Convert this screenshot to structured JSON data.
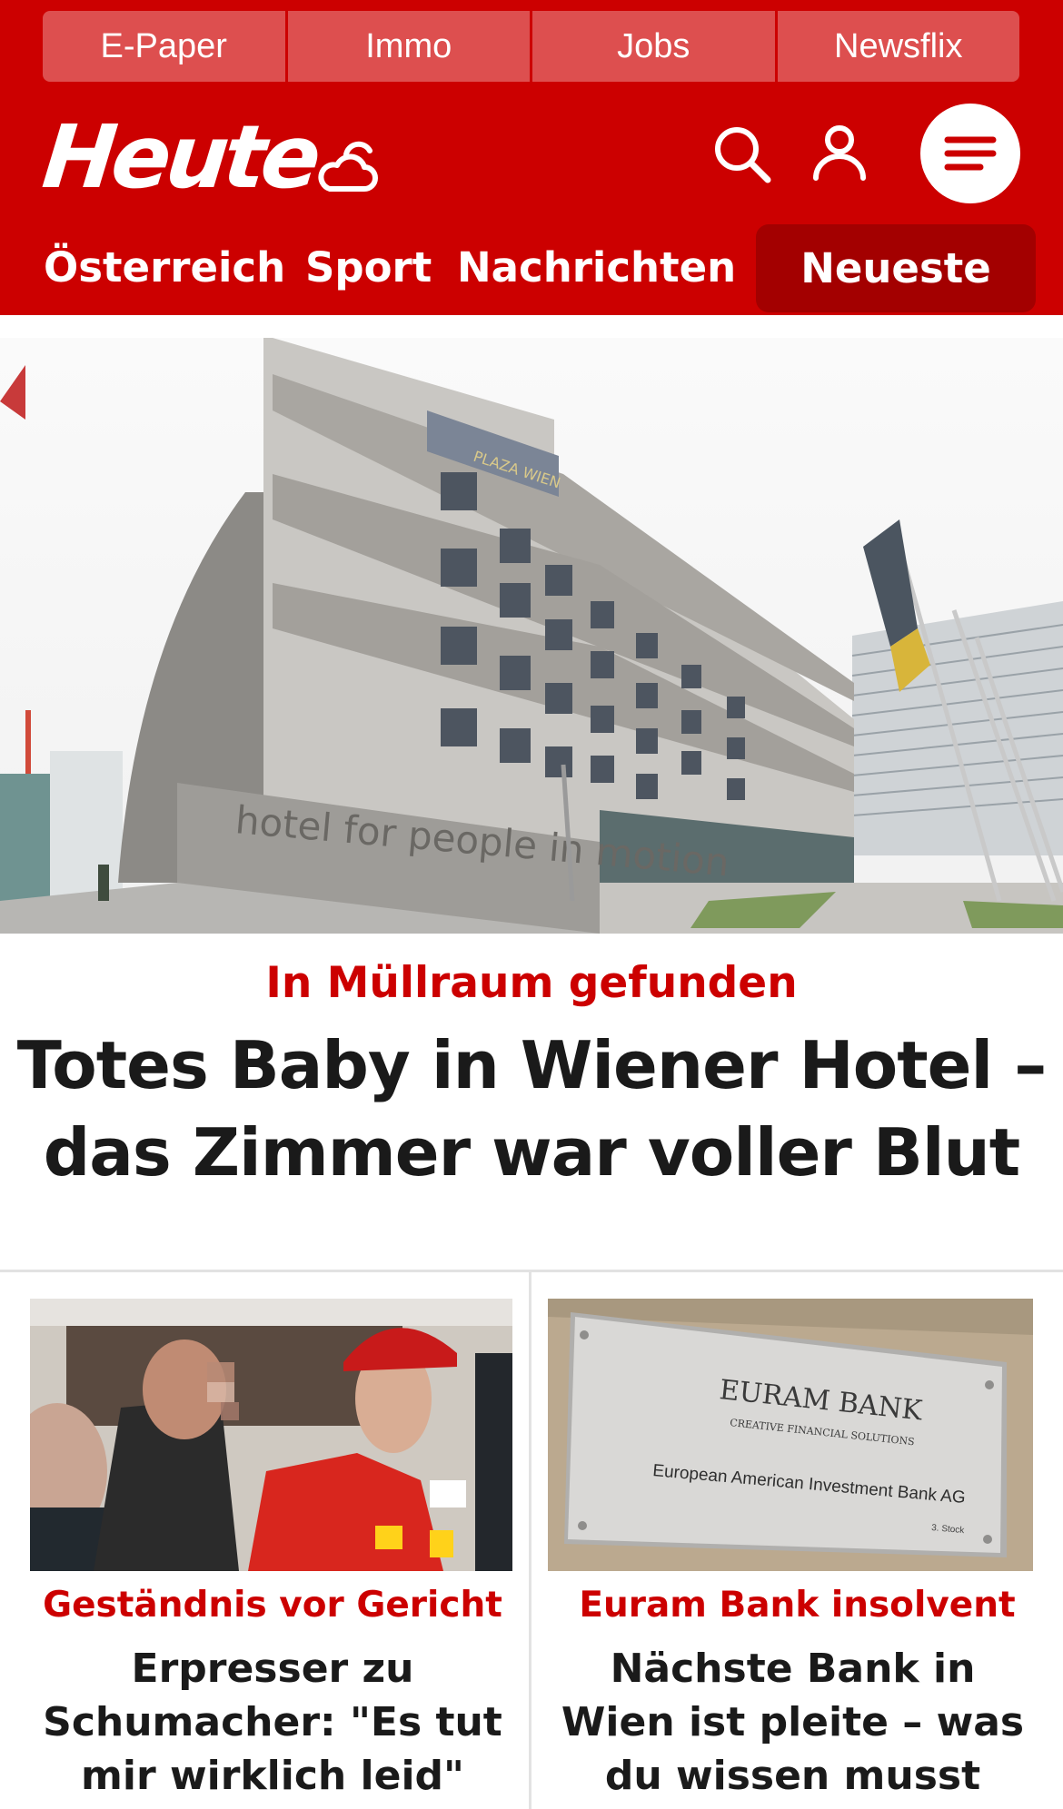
{
  "services": [
    "E-Paper",
    "Immo",
    "Jobs",
    "Newsflix"
  ],
  "brand": {
    "logo": "Heute",
    "weather_icon": "cloud-sun-icon"
  },
  "header_icons": {
    "search": "search-icon",
    "account": "user-icon",
    "menu": "hamburger-menu-icon"
  },
  "nav": {
    "osterreich": "Österreich",
    "sport": "Sport",
    "nachrichten": "Nachrichten",
    "neueste": "Neueste"
  },
  "hero": {
    "image_text": "hotel for people in motion",
    "sign_text": "PLAZA WIEN",
    "kicker": "In Müllraum gefunden",
    "title": "Totes Baby in Wiener Hotel – das Zimmer war voller Blut"
  },
  "cards": [
    {
      "kicker": "Geständnis vor Gericht",
      "title": "Erpresser zu Schumacher: \"Es tut mir wirklich leid\""
    },
    {
      "kicker": "Euram Bank insolvent",
      "title": "Nächste Bank in Wien ist pleite – was du wissen musst",
      "plaque": {
        "name": "EURAM BANK",
        "tagline": "CREATIVE FINANCIAL SOLUTIONS",
        "full": "European American Investment Bank AG",
        "floor": "3. Stock"
      }
    }
  ],
  "colors": {
    "brand_red": "#cc0000",
    "service_bg": "#dd4f4f",
    "active_tab": "#a30000",
    "text": "#1a1a1a"
  }
}
